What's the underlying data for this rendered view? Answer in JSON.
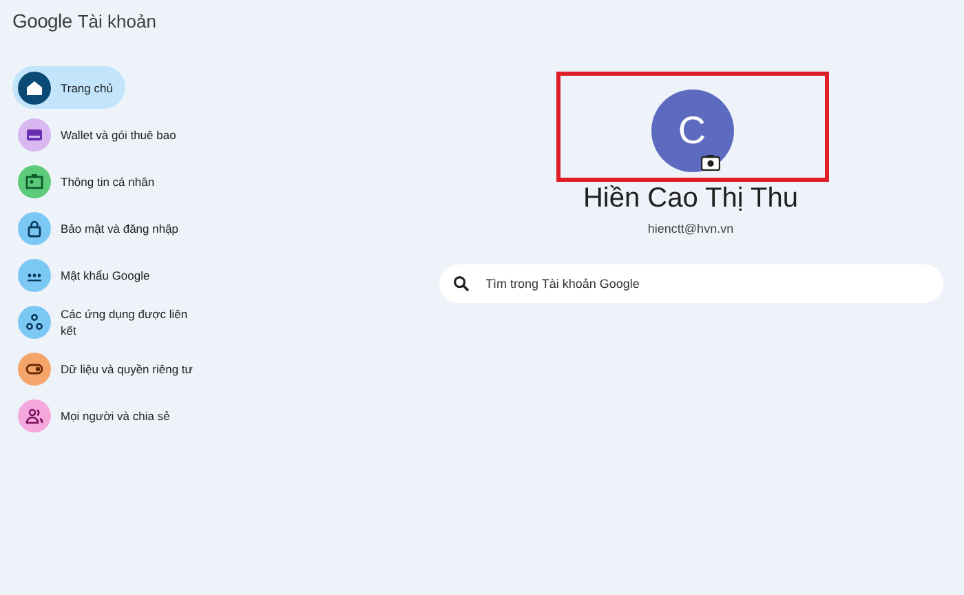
{
  "header": {
    "logo": "Google",
    "title": "Tài khoản"
  },
  "sidebar": {
    "items": [
      {
        "label": "Trang chủ",
        "selected": true,
        "color": "#0b4a75"
      },
      {
        "label": "Wallet và gói thuê bao",
        "selected": false,
        "color": "#d9b8f2"
      },
      {
        "label": "Thông tin cá nhân",
        "selected": false,
        "color": "#5ccb7a"
      },
      {
        "label": "Bảo mật và đăng nhập",
        "selected": false,
        "color": "#7cc8f5"
      },
      {
        "label": "Mật khẩu Google",
        "selected": false,
        "color": "#7cc8f5"
      },
      {
        "label": "Các ứng dụng được liên kết",
        "selected": false,
        "color": "#7cc8f5"
      },
      {
        "label": "Dữ liệu và quyền riêng tư",
        "selected": false,
        "color": "#f5a56a"
      },
      {
        "label": "Mọi người và chia sẻ",
        "selected": false,
        "color": "#f4a8dc"
      }
    ]
  },
  "profile": {
    "initial": "C",
    "highlighted": true,
    "name": "Hiền Cao Thị Thu",
    "email": "hienctt@hvn.vn"
  },
  "search": {
    "placeholder": "Tìm trong Tài khoản Google"
  }
}
